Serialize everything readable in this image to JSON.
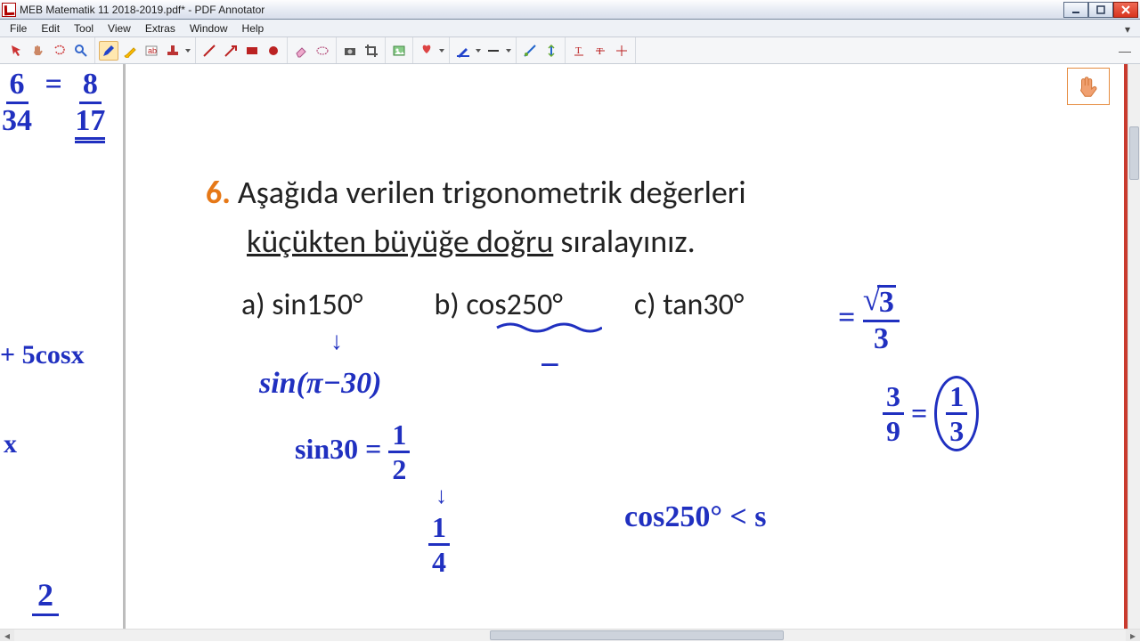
{
  "title": "MEB Matematik 11 2018-2019.pdf* - PDF Annotator",
  "menu": {
    "file": "File",
    "edit": "Edit",
    "tool": "Tool",
    "view": "View",
    "extras": "Extras",
    "window": "Window",
    "help": "Help"
  },
  "problem": {
    "num": "6.",
    "line1": "Aşağıda verilen trigonometrik değerleri",
    "line2_underlined": "küçükten büyüğe doğru",
    "line2_rest": " sıralayınız.",
    "opt_a": "a) sin150°",
    "opt_b": "b) cos250°",
    "opt_c": "c) tan30°"
  },
  "handwriting": {
    "left_top_frac_lhs_n": "6",
    "left_top_frac_lhs_d": "34",
    "left_top_eq": "=",
    "left_top_frac_rhs_n": "8",
    "left_top_frac_rhs_d": "17",
    "left_mid": "+ 5cosx",
    "left_x": "x",
    "left_bottom": "2",
    "a_arrow": "↓",
    "a_expr": "sin(π−30)",
    "a_val_lhs": "sin30 =",
    "a_val_n": "1",
    "a_val_d": "2",
    "a_sq_arrow": "↓",
    "a_sq_n": "1",
    "a_sq_d": "4",
    "b_minus": "−",
    "c_eq": "=",
    "c_val_n": "√3",
    "c_val_d": "3",
    "c_sq_lhs_n": "3",
    "c_sq_lhs_d": "9",
    "c_sq_eq": "=",
    "c_sq_rhs_n": "1",
    "c_sq_rhs_d": "3",
    "compare": "cos250°  <  s"
  }
}
